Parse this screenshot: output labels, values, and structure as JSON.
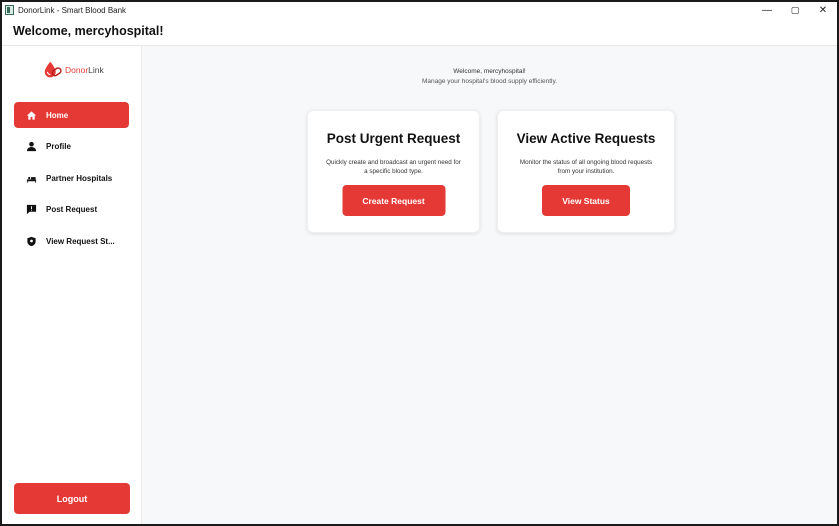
{
  "window": {
    "title": "DonorLink - Smart Blood Bank",
    "controls": {
      "minimize": "—",
      "maximize": "▢",
      "close": "✕"
    }
  },
  "header": {
    "title": "Welcome, mercyhospital!"
  },
  "sidebar": {
    "logo": {
      "donor": "Donor",
      "link": "Link",
      "icon": "blood-drop-link-icon"
    },
    "items": [
      {
        "label": "Home",
        "icon": "home-icon",
        "active": true
      },
      {
        "label": "Profile",
        "icon": "person-icon",
        "active": false
      },
      {
        "label": "Partner Hospitals",
        "icon": "hospital-bed-icon",
        "active": false
      },
      {
        "label": "Post Request",
        "icon": "alert-message-icon",
        "active": false
      },
      {
        "label": "View Request St...",
        "icon": "status-shield-icon",
        "active": false
      }
    ],
    "logout_label": "Logout"
  },
  "main": {
    "welcome": "Welcome, mercyhospital!",
    "subtitle": "Manage your hospital's blood supply efficiently.",
    "cards": [
      {
        "title": "Post Urgent Request",
        "description": "Quickly create and broadcast an urgent need for a specific blood type.",
        "button_label": "Create Request"
      },
      {
        "title": "View Active Requests",
        "description": "Monitor the status of all ongoing blood requests from your institution.",
        "button_label": "View Status"
      }
    ]
  },
  "colors": {
    "accent": "#e53935",
    "background": "#f7f8fa",
    "surface": "#ffffff"
  }
}
